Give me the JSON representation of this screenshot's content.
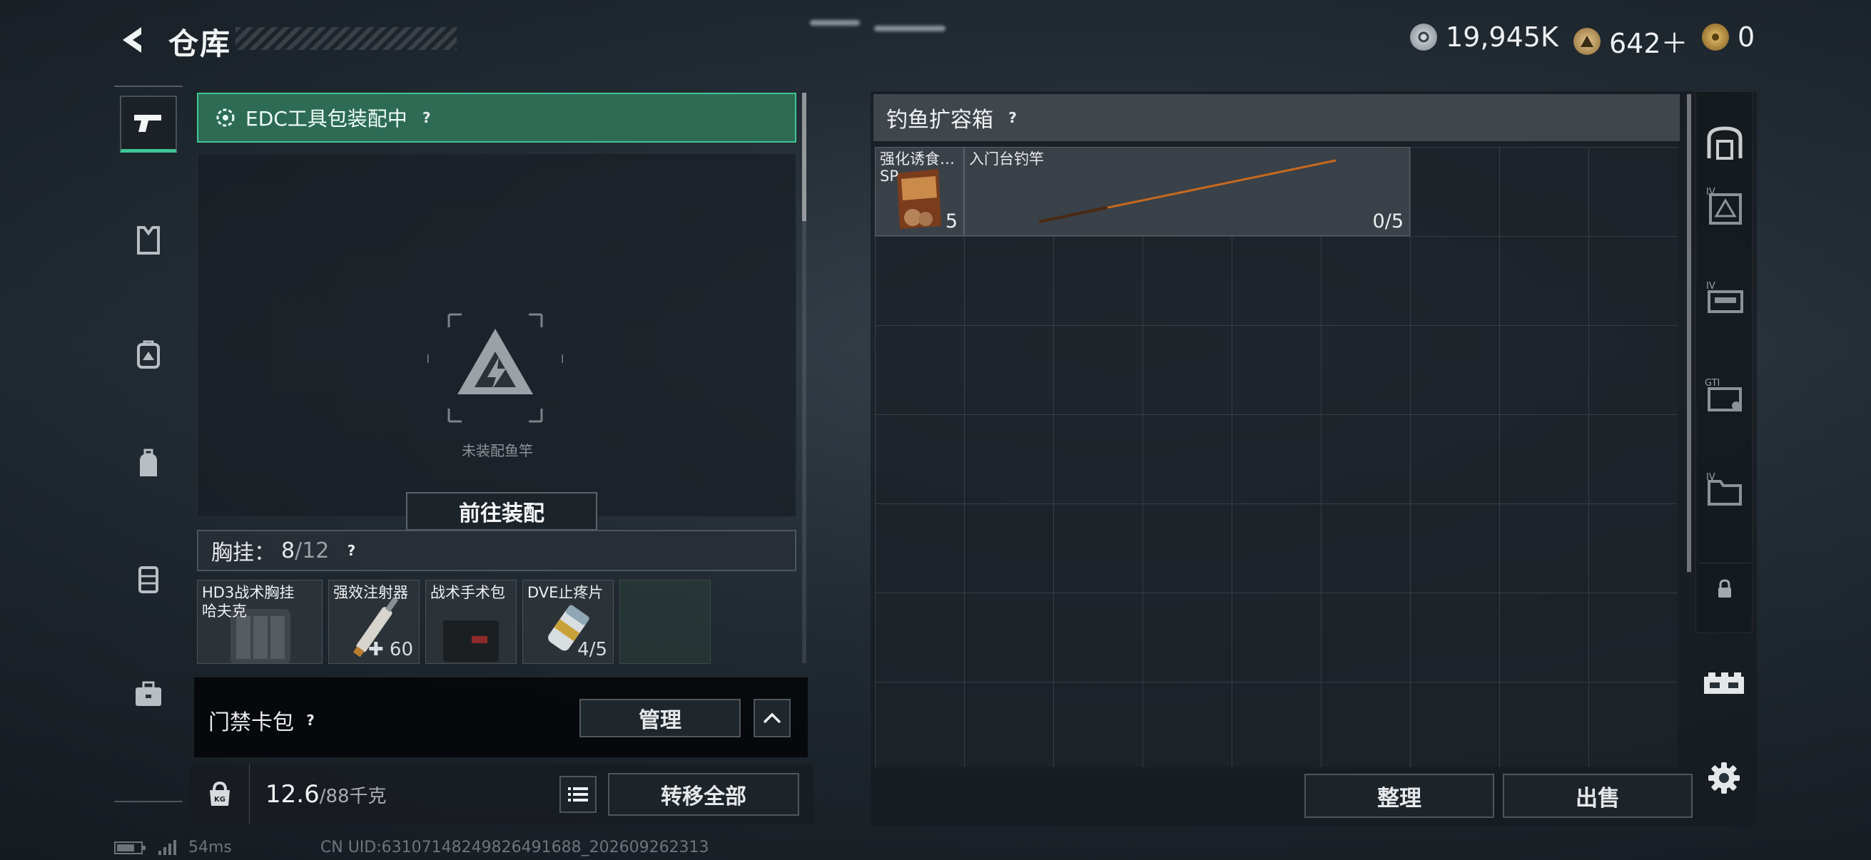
{
  "header": {
    "title": "仓库",
    "currencies": [
      {
        "icon": "silver-coin-icon",
        "value": "19,945K"
      },
      {
        "icon": "triangle-coin-icon",
        "value": "642＋"
      },
      {
        "icon": "gold-coin-icon",
        "value": "0"
      }
    ]
  },
  "left_nav": [
    {
      "name": "pistol-icon",
      "active": true
    },
    {
      "name": "armor-vest-icon",
      "active": false
    },
    {
      "name": "helmet-bag-icon",
      "active": false
    },
    {
      "name": "backpack-icon",
      "active": false
    },
    {
      "name": "chest-rig-icon",
      "active": false
    },
    {
      "name": "briefcase-icon",
      "active": false
    }
  ],
  "equip_panel": {
    "banner_text": "EDC工具包装配中",
    "help": "?",
    "empty_label": "未装配鱼竿",
    "goto_button": "前往装配"
  },
  "vest": {
    "label": "胸挂：",
    "count": "8",
    "max": "/12",
    "help": "?",
    "items": [
      {
        "name": "HD3战术胸挂\n哈夫克",
        "count": ""
      },
      {
        "name": "强效注射器",
        "count": "✚ 60"
      },
      {
        "name": "战术手术包",
        "count": ""
      },
      {
        "name": "DVE止疼片",
        "count": "4/5"
      },
      {
        "name": "",
        "count": ""
      }
    ]
  },
  "keycard": {
    "label": "门禁卡包",
    "help": "?",
    "manage_button": "管理"
  },
  "weight": {
    "current": "12.6",
    "max": "/88千克",
    "transfer_button": "转移全部"
  },
  "container": {
    "title": "钓鱼扩容箱",
    "help": "?",
    "items": [
      {
        "name": "强化诱食…\nSP",
        "count": "5"
      },
      {
        "name": "入门台钓竿",
        "count": "0/5"
      }
    ],
    "sort_button": "整理",
    "sell_button": "出售"
  },
  "right_tabs": [
    {
      "name": "safe-box-icon",
      "tag": ""
    },
    {
      "name": "triangle-case-icon",
      "tag": "IV"
    },
    {
      "name": "weapon-case-icon",
      "tag": "IV"
    },
    {
      "name": "gti-case-icon",
      "tag": "GTI"
    },
    {
      "name": "folder-case-icon",
      "tag": "IV"
    },
    {
      "name": "lock-icon",
      "tag": ""
    }
  ],
  "footer": {
    "ping": "54ms",
    "uid": "CN UID:63107148249826491688_202609262313"
  },
  "colors": {
    "accent_green": "#3fc493",
    "banner_bg": "#2d6b55",
    "rod_orange": "#c8691f"
  }
}
